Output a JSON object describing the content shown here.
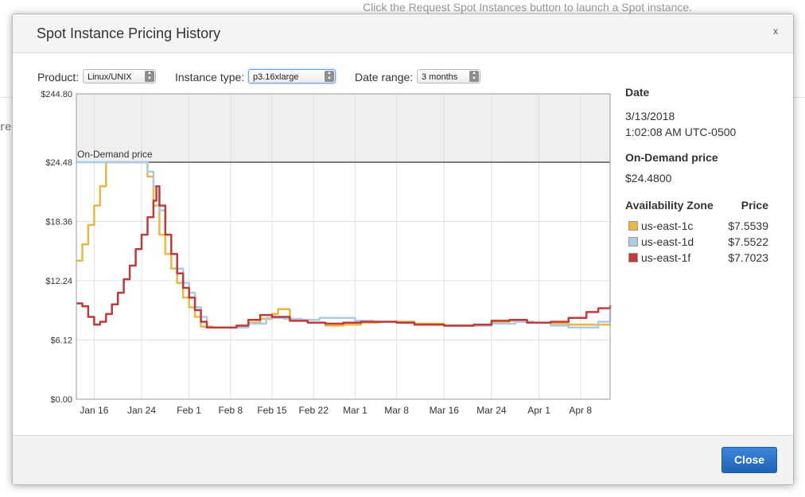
{
  "background": {
    "hint": "Click the Request Spot Instances button to launch a Spot instance.",
    "fragment": "re"
  },
  "modal": {
    "title": "Spot Instance Pricing History",
    "close_x": "x"
  },
  "filters": {
    "product_label": "Product:",
    "product_value": "Linux/UNIX",
    "instance_label": "Instance type:",
    "instance_value": "p3.16xlarge",
    "range_label": "Date range:",
    "range_value": "3 months"
  },
  "details": {
    "date_label": "Date",
    "date_value": "3/13/2018",
    "time_value": "1:02:08 AM UTC-0500",
    "ondemand_label": "On-Demand price",
    "ondemand_value": "$24.4800",
    "az_header": "Availability Zone",
    "price_header": "Price",
    "zones": [
      {
        "name": "us-east-1c",
        "price": "$7.5539",
        "color": "#e9b840"
      },
      {
        "name": "us-east-1d",
        "price": "$7.5522",
        "color": "#a9cbe8"
      },
      {
        "name": "us-east-1f",
        "price": "$7.7023",
        "color": "#c0393b"
      }
    ]
  },
  "footer": {
    "close_label": "Close"
  },
  "chart_data": {
    "type": "line",
    "annotation": "On-Demand price",
    "y_ticks": [
      "$0.00",
      "$6.12",
      "$12.24",
      "$18.36",
      "$24.48",
      "$244.80"
    ],
    "y_tick_values": [
      0,
      6.12,
      12.24,
      18.36,
      24.48,
      244.8
    ],
    "x_ticks": [
      "Jan 16",
      "Jan 24",
      "Feb 1",
      "Feb 8",
      "Feb 15",
      "Feb 22",
      "Mar 1",
      "Mar 8",
      "Mar 16",
      "Mar 24",
      "Apr 1",
      "Apr 8"
    ],
    "x_tick_days": [
      16,
      24,
      32,
      39,
      46,
      53,
      60,
      67,
      75,
      83,
      91,
      98
    ],
    "x_range_days": [
      13,
      103
    ],
    "x_range_dates": [
      "2018-01-13",
      "2018-04-13"
    ],
    "y_axis_breaks": {
      "linear_max": 24.48,
      "top_max": 244.8
    },
    "ondemand_price": 24.48,
    "grid": true,
    "series": [
      {
        "name": "us-east-1c",
        "color": "#e9b840",
        "points": [
          [
            13,
            14.3
          ],
          [
            14,
            16
          ],
          [
            15,
            18
          ],
          [
            16,
            20
          ],
          [
            17,
            22
          ],
          [
            18,
            24.48
          ],
          [
            24,
            24.48
          ],
          [
            25,
            23.0
          ],
          [
            26,
            20.0
          ],
          [
            27,
            17.0
          ],
          [
            28,
            15.0
          ],
          [
            29,
            13.5
          ],
          [
            30,
            12.0
          ],
          [
            31,
            10.5
          ],
          [
            32,
            9.5
          ],
          [
            33,
            8.5
          ],
          [
            34,
            7.5
          ],
          [
            36,
            7.4
          ],
          [
            38,
            7.4
          ],
          [
            40,
            7.6
          ],
          [
            42,
            7.9
          ],
          [
            44,
            8.3
          ],
          [
            46,
            8.8
          ],
          [
            47,
            9.3
          ],
          [
            48,
            9.3
          ],
          [
            49,
            8.2
          ],
          [
            52,
            7.9
          ],
          [
            55,
            7.6
          ],
          [
            58,
            7.7
          ],
          [
            61,
            7.9
          ],
          [
            64,
            8.0
          ],
          [
            67,
            8.0
          ],
          [
            70,
            7.8
          ],
          [
            75,
            7.6
          ],
          [
            80,
            7.6
          ],
          [
            83,
            8.0
          ],
          [
            86,
            8.1
          ],
          [
            89,
            7.9
          ],
          [
            93,
            7.8
          ],
          [
            96,
            7.7
          ],
          [
            103,
            7.6
          ]
        ]
      },
      {
        "name": "us-east-1d",
        "color": "#a9cbe8",
        "points": [
          [
            13,
            24.48
          ],
          [
            24,
            24.48
          ],
          [
            25,
            23.5
          ],
          [
            26,
            22.0
          ],
          [
            27,
            19.5
          ],
          [
            28,
            17.0
          ],
          [
            29,
            15.0
          ],
          [
            30,
            13.5
          ],
          [
            31,
            12.0
          ],
          [
            32,
            11.0
          ],
          [
            33,
            9.5
          ],
          [
            34,
            8.5
          ],
          [
            35,
            7.4
          ],
          [
            38,
            7.4
          ],
          [
            40,
            7.4
          ],
          [
            42,
            7.8
          ],
          [
            45,
            8.4
          ],
          [
            48,
            8.3
          ],
          [
            51,
            8.2
          ],
          [
            54,
            8.4
          ],
          [
            57,
            8.4
          ],
          [
            60,
            8.1
          ],
          [
            63,
            8.0
          ],
          [
            67,
            7.9
          ],
          [
            70,
            7.7
          ],
          [
            75,
            7.6
          ],
          [
            80,
            7.6
          ],
          [
            83,
            7.8
          ],
          [
            87,
            8.0
          ],
          [
            90,
            7.9
          ],
          [
            93,
            7.6
          ],
          [
            96,
            7.4
          ],
          [
            99,
            7.4
          ],
          [
            101,
            8.0
          ],
          [
            103,
            9.4
          ]
        ]
      },
      {
        "name": "us-east-1f",
        "color": "#c0393b",
        "points": [
          [
            13,
            9.9
          ],
          [
            14,
            9.6
          ],
          [
            15,
            8.5
          ],
          [
            16,
            7.7
          ],
          [
            17,
            8.0
          ],
          [
            18,
            8.8
          ],
          [
            19,
            9.8
          ],
          [
            20,
            11.0
          ],
          [
            21,
            12.4
          ],
          [
            22,
            13.8
          ],
          [
            23,
            15.5
          ],
          [
            24,
            17.0
          ],
          [
            25,
            18.8
          ],
          [
            26,
            20.5
          ],
          [
            26.5,
            22.0
          ],
          [
            27,
            20.0
          ],
          [
            28,
            17.0
          ],
          [
            29,
            15.0
          ],
          [
            30,
            13.0
          ],
          [
            31,
            11.5
          ],
          [
            32,
            10.5
          ],
          [
            33,
            9.2
          ],
          [
            34,
            8.0
          ],
          [
            35,
            7.4
          ],
          [
            38,
            7.4
          ],
          [
            40,
            7.6
          ],
          [
            42,
            8.2
          ],
          [
            44,
            8.7
          ],
          [
            46,
            8.5
          ],
          [
            49,
            8.1
          ],
          [
            52,
            7.9
          ],
          [
            55,
            7.8
          ],
          [
            58,
            7.9
          ],
          [
            61,
            8.0
          ],
          [
            64,
            8.0
          ],
          [
            67,
            7.9
          ],
          [
            70,
            7.7
          ],
          [
            75,
            7.6
          ],
          [
            80,
            7.7
          ],
          [
            83,
            8.1
          ],
          [
            86,
            8.2
          ],
          [
            89,
            7.9
          ],
          [
            93,
            8.0
          ],
          [
            96,
            8.4
          ],
          [
            99,
            9.0
          ],
          [
            101,
            9.4
          ],
          [
            103,
            9.7
          ]
        ]
      }
    ]
  }
}
